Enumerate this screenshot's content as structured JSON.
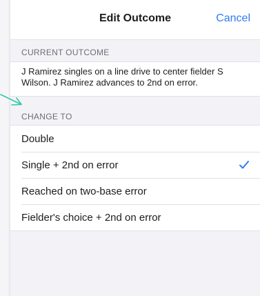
{
  "navbar": {
    "title": "Edit Outcome",
    "cancel_label": "Cancel"
  },
  "current_outcome": {
    "header": "CURRENT OUTCOME",
    "text": "J Ramirez singles on a line drive to center fielder S Wilson. J Ramirez advances to 2nd on error."
  },
  "change_to": {
    "header": "CHANGE TO",
    "options": [
      {
        "label": "Double",
        "selected": false
      },
      {
        "label": "Single + 2nd on error",
        "selected": true
      },
      {
        "label": "Reached on two-base error",
        "selected": false
      },
      {
        "label": "Fielder's choice + 2nd on error",
        "selected": false
      }
    ]
  },
  "colors": {
    "accent": "#2f7bf6",
    "pointer_arrow": "#2ec9a7"
  },
  "icons": {
    "selected_marker": "checkmark-icon",
    "pointer": "arrow-pointer-icon"
  }
}
